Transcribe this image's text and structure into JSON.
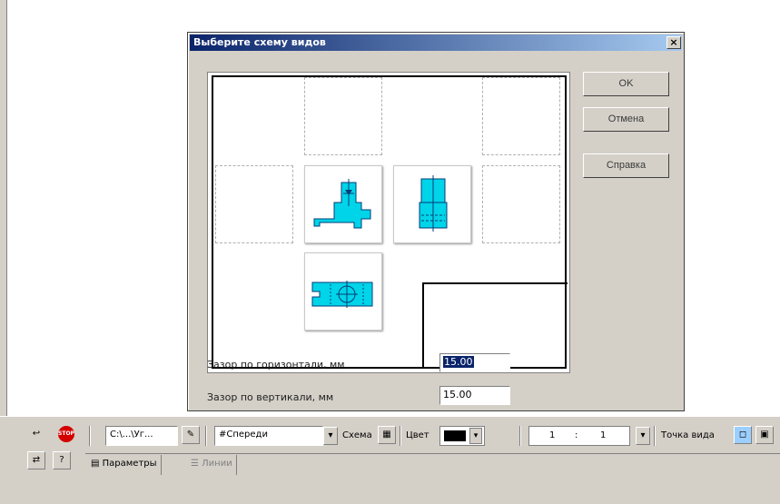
{
  "dialog": {
    "title": "Выберите схему видов",
    "close_glyph": "×",
    "buttons": {
      "ok": "OK",
      "cancel": "Отмена",
      "help": "Справка"
    },
    "fields": {
      "horizontal_gap_label": "Зазор по горизонтали, мм",
      "horizontal_gap_value": "15.00",
      "vertical_gap_label": "Зазор по вертикали, мм",
      "vertical_gap_value": "15.00"
    },
    "views": [
      "front-view",
      "left-view",
      "top-view"
    ]
  },
  "toolbar": {
    "file_path": "C:\\...\\Уг...",
    "orientation": "#Спереди",
    "scheme_label": "Схема",
    "color_label": "Цвет",
    "scale_left": "1",
    "scale_sep": ":",
    "scale_right": "1",
    "view_point_label": "Точка вида",
    "tabs": {
      "params": "Параметры",
      "lines": "Линии"
    }
  },
  "colors": {
    "title_start": "#0a246a",
    "title_end": "#a6caf0",
    "part_fill": "#00d4e8",
    "part_stroke": "#003c78"
  }
}
